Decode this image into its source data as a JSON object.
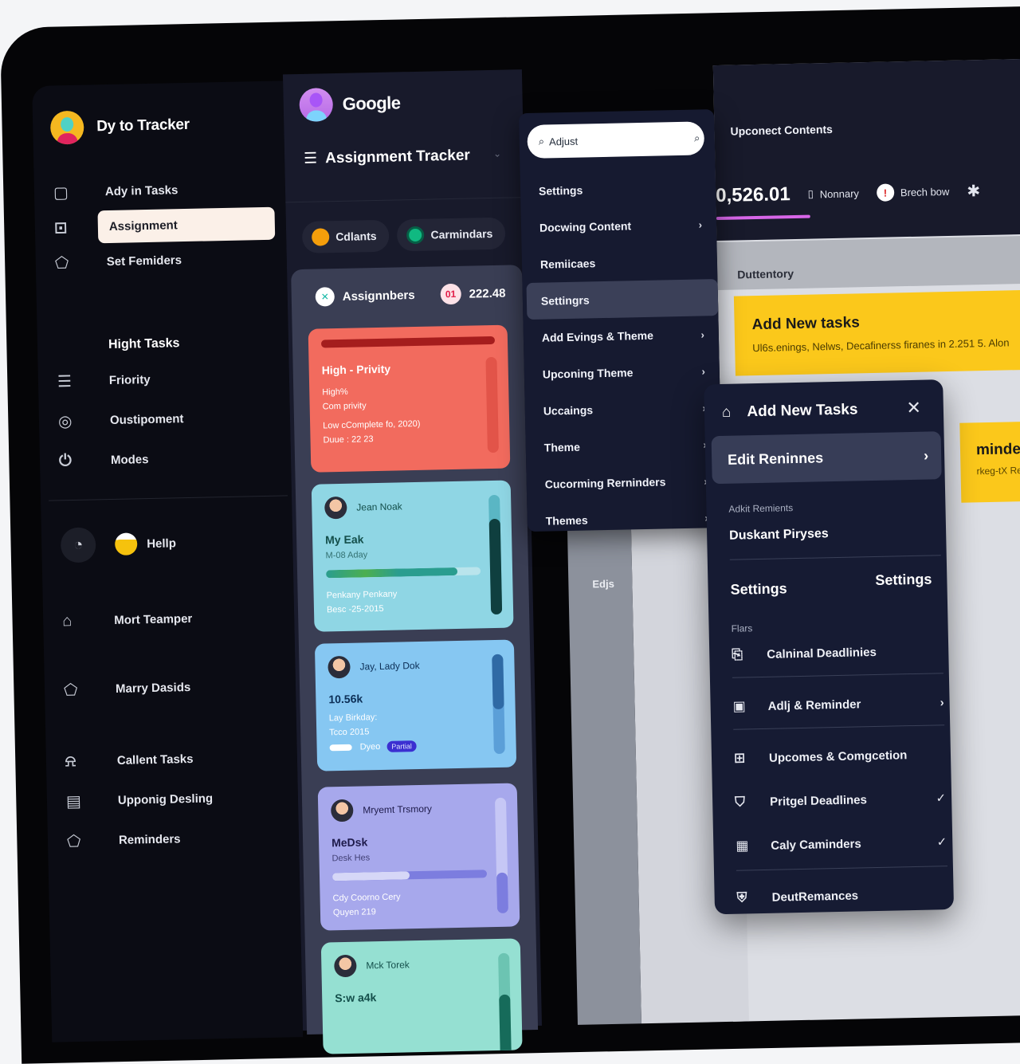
{
  "sidebar": {
    "app_title": "Dy to Tracker",
    "top_items": [
      {
        "label": "Ady in Tasks",
        "icon": "bookmark-icon"
      },
      {
        "label": "Assignment",
        "icon": "document-search-icon",
        "active": true
      },
      {
        "label": "Set Femiders",
        "icon": "pentagon-icon"
      }
    ],
    "section_heading": "Hight Tasks",
    "section_items": [
      {
        "label": "Friority",
        "icon": "list-icon"
      },
      {
        "label": "Oustipoment",
        "icon": "target-icon"
      },
      {
        "label": "Modes",
        "icon": "power-icon"
      }
    ],
    "help_label": "Hellp",
    "bottom_items": [
      {
        "label": "Mort Teamper",
        "icon": "home-icon"
      },
      {
        "label": "Marry Dasids",
        "icon": "pentagon-icon"
      },
      {
        "label": "Callent Tasks",
        "icon": "bell-icon"
      },
      {
        "label": "Upponig Desling",
        "icon": "calendar-icon"
      },
      {
        "label": "Reminders",
        "icon": "pentagon-icon"
      }
    ]
  },
  "middle": {
    "account_name": "Google",
    "page_title": "Assignment Tracker",
    "chips": [
      {
        "label": "Cdlants",
        "color": "#f59e0b"
      },
      {
        "label": "Carmindars",
        "color": "#10b981"
      }
    ],
    "panel": {
      "title": "Assignnbers",
      "badge": "01",
      "value": "222.48"
    },
    "cards": [
      {
        "title": "High - Privity",
        "lines": [
          "High%",
          "Com privity",
          "Low cComplete fo, 2020)",
          "Duue : 22 23"
        ],
        "bg": "#f26b5e"
      },
      {
        "person": "Jean Noak",
        "title": "My Eak",
        "sub": "M-08 Aday",
        "progress": 0.85,
        "lines": [
          "Penkany Penkany",
          "Besc -25-2015"
        ],
        "bg": "#8fd6e4",
        "side_progress": 0.8
      },
      {
        "person": "Jay, Lady Dok",
        "title": "10.56k",
        "lines": [
          "Lay Birkday:",
          "Tcco 2015"
        ],
        "footer": "Dyeo",
        "tag": "Partial",
        "bg": "#86c7f2",
        "side_progress": 0.55
      },
      {
        "person": "Mryemt Trsmory",
        "title": "MeDsk",
        "sub": "Desk Hes",
        "progress": 0.5,
        "lines": [
          "Cdy Coorno Cery",
          "Quyen 219"
        ],
        "bg": "#a7a8ec",
        "side_progress": 0.35
      },
      {
        "person": "Mck Torek",
        "title": "S:w a4k",
        "bg": "#95e0d2",
        "side_progress": 0.6
      }
    ]
  },
  "menu": {
    "search_value": "Adjust",
    "items": [
      {
        "label": "Settings",
        "arrow": false
      },
      {
        "label": "Docwing Content",
        "arrow": true
      },
      {
        "label": "Remiicaes",
        "arrow": false
      },
      {
        "label": "Settingrs",
        "arrow": false,
        "active": true
      },
      {
        "label": "Add Evings & Theme",
        "arrow": true
      },
      {
        "label": "Upconing Theme",
        "arrow": true
      },
      {
        "label": "Uccaings",
        "arrow": true
      },
      {
        "label": "Theme",
        "arrow": true
      },
      {
        "label": "Cucorming Rerninders",
        "arrow": true
      },
      {
        "label": "Themes",
        "arrow": true
      }
    ]
  },
  "right": {
    "top_label": "Upconect Contents",
    "big_value": "0,526.01",
    "stat1": "Nonnary",
    "stat2": "Brech bow",
    "section_label": "Duttentory",
    "banner1_title": "Add New tasks",
    "banner1_sub": "Ul6s.enings, Nelws, Decafinerss firanes in 2.251 5. Alon",
    "banner2_title": "minders",
    "banner2_sub": "rkeg-tX Reminu",
    "side_label": "Edjs"
  },
  "popup": {
    "title": "Add New Tasks",
    "edit_label": "Edit Reninnes",
    "sub_label": "Adkit Remients",
    "sub_text": "Duskant Piryses",
    "settings_left": "Settings",
    "settings_right": "Settings",
    "group_label": "Flars",
    "rows": [
      {
        "label": "Calninal Deadlinies",
        "icon": "clipboard-icon",
        "end": ""
      },
      {
        "label": "Adlj & Reminder",
        "icon": "folder-icon",
        "end": "›"
      },
      {
        "label": "Upcomes & Comgcetion",
        "icon": "briefcase-icon",
        "end": ""
      },
      {
        "label": "Pritgel Deadlines",
        "icon": "shield-icon",
        "end": "✓"
      },
      {
        "label": "Caly Caminders",
        "icon": "calendar-icon",
        "end": "✓"
      },
      {
        "label": "DeutRemances",
        "icon": "lock-shield-icon",
        "end": ""
      }
    ]
  }
}
